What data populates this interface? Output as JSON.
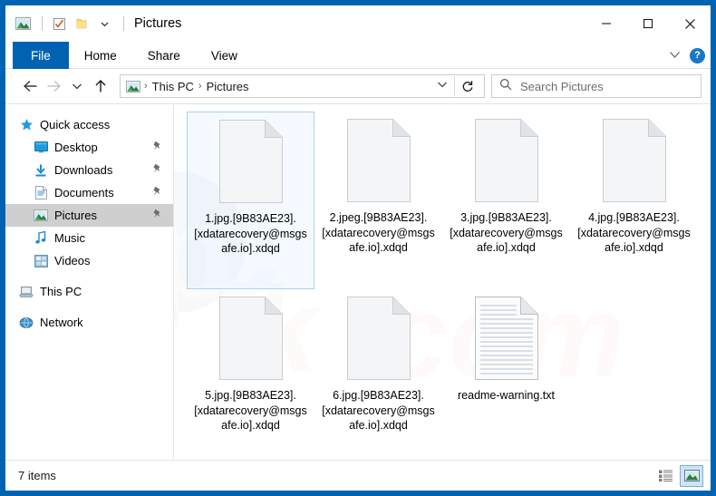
{
  "window": {
    "title": "Pictures",
    "frame_color": "#0063b1",
    "quick_access": [
      {
        "name": "pictures-folder-icon",
        "label": "Pictures"
      },
      {
        "name": "properties-icon",
        "label": "Properties"
      },
      {
        "name": "new-folder-icon",
        "label": "New folder"
      },
      {
        "name": "customize-chevron-icon",
        "label": "Customize Quick Access Toolbar"
      }
    ],
    "controls": {
      "minimize": "─",
      "maximize": "□",
      "close": "✕"
    }
  },
  "ribbon": {
    "tabs": [
      {
        "label": "File",
        "active": true
      },
      {
        "label": "Home",
        "active": false
      },
      {
        "label": "Share",
        "active": false
      },
      {
        "label": "View",
        "active": false
      }
    ],
    "expand_chevron": "∨",
    "help_label": "?"
  },
  "addressbar": {
    "back": "←",
    "forward": "→",
    "history": "∨",
    "up": "↑",
    "breadcrumb": [
      "This PC",
      "Pictures"
    ],
    "breadcrumb_sep": "›",
    "dropdown_chevron": "∨",
    "refresh": "↻"
  },
  "search": {
    "placeholder": "Search Pictures",
    "icon": "search-icon"
  },
  "sidebar": {
    "items": [
      {
        "label": "Quick access",
        "icon": "star-icon",
        "indent": false,
        "pinned": false,
        "selected": false
      },
      {
        "label": "Desktop",
        "icon": "desktop-icon",
        "indent": true,
        "pinned": true,
        "selected": false
      },
      {
        "label": "Downloads",
        "icon": "downloads-icon",
        "indent": true,
        "pinned": true,
        "selected": false
      },
      {
        "label": "Documents",
        "icon": "documents-icon",
        "indent": true,
        "pinned": true,
        "selected": false
      },
      {
        "label": "Pictures",
        "icon": "pictures-icon",
        "indent": true,
        "pinned": true,
        "selected": true
      },
      {
        "label": "Music",
        "icon": "music-icon",
        "indent": true,
        "pinned": false,
        "selected": false
      },
      {
        "label": "Videos",
        "icon": "videos-icon",
        "indent": true,
        "pinned": false,
        "selected": false
      },
      {
        "label": "This PC",
        "icon": "this-pc-icon",
        "indent": false,
        "pinned": false,
        "selected": false
      },
      {
        "label": "Network",
        "icon": "network-icon",
        "indent": false,
        "pinned": false,
        "selected": false
      }
    ],
    "pin_glyph": "📌"
  },
  "files": [
    {
      "name": "1.jpg.[9B83AE23].[xdatarecovery@msgsafe.io].xdqd",
      "icon": "blank-file-icon",
      "selected": true
    },
    {
      "name": "2.jpeg.[9B83AE23].[xdatarecovery@msgsafe.io].xdqd",
      "icon": "blank-file-icon",
      "selected": false
    },
    {
      "name": "3.jpg.[9B83AE23].[xdatarecovery@msgsafe.io].xdqd",
      "icon": "blank-file-icon",
      "selected": false
    },
    {
      "name": "4.jpg.[9B83AE23].[xdatarecovery@msgsafe.io].xdqd",
      "icon": "blank-file-icon",
      "selected": false
    },
    {
      "name": "5.jpg.[9B83AE23].[xdatarecovery@msgsafe.io].xdqd",
      "icon": "blank-file-icon",
      "selected": false
    },
    {
      "name": "6.jpg.[9B83AE23].[xdatarecovery@msgsafe.io].xdqd",
      "icon": "blank-file-icon",
      "selected": false
    },
    {
      "name": "readme-warning.txt",
      "icon": "text-file-icon",
      "selected": false
    }
  ],
  "statusbar": {
    "item_count": "7 items",
    "views": [
      {
        "name": "details-view-button",
        "active": false
      },
      {
        "name": "large-icons-view-button",
        "active": true
      }
    ]
  },
  "watermark": {
    "text": "pcrisk.com"
  }
}
